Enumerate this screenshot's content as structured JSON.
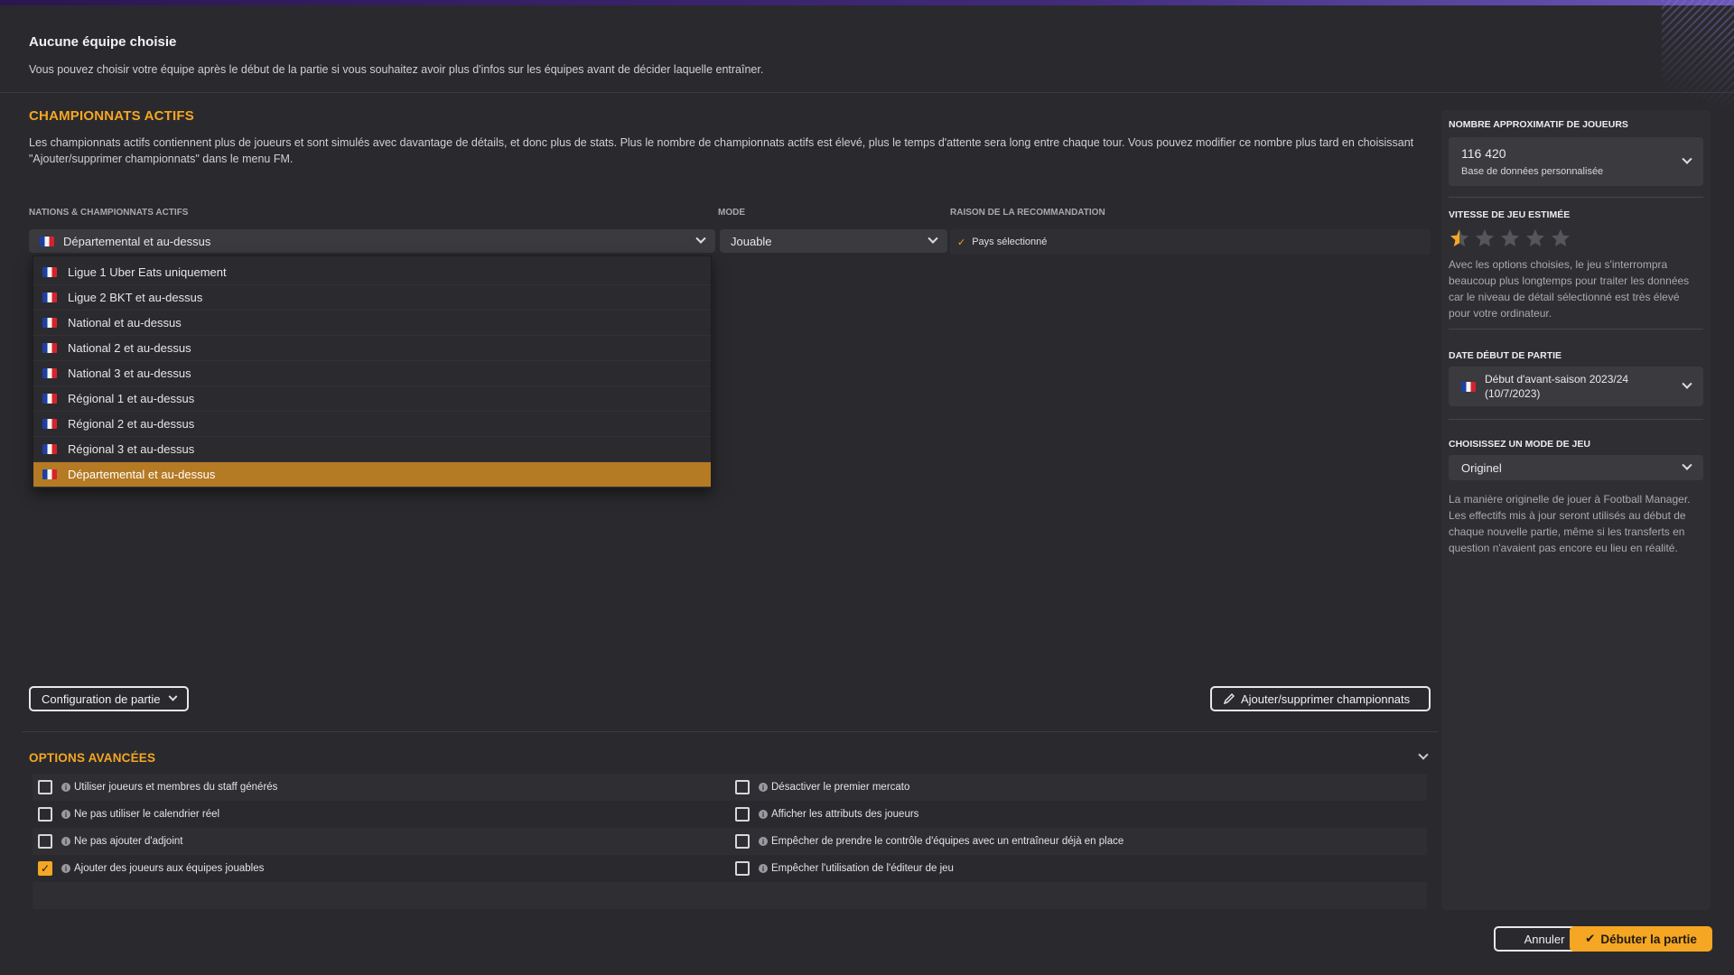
{
  "header": {
    "title": "Aucune équipe choisie",
    "subtitle": "Vous pouvez choisir votre équipe après le début de la partie si vous souhaitez avoir plus d'infos sur les équipes avant de décider laquelle entraîner."
  },
  "main": {
    "title": "CHAMPIONNATS ACTIFS",
    "description": "Les championnats actifs contiennent plus de joueurs et sont simulés avec davantage de détails, et donc plus de stats. Plus le nombre de championnats actifs est élevé, plus le temps d'attente sera long entre chaque tour. Vous pouvez modifier ce nombre plus tard en choisissant \"Ajouter/supprimer championnats\" dans le menu FM.",
    "columns": {
      "nations": "NATIONS & CHAMPIONNATS ACTIFS",
      "mode": "MODE",
      "reason": "RAISON DE LA RECOMMANDATION"
    },
    "nation_select": {
      "value": "Départemental et au-dessus"
    },
    "mode_select": {
      "value": "Jouable"
    },
    "reason": "Pays sélectionné",
    "dropdown_items": [
      {
        "label": "Ligue 1 Uber Eats uniquement"
      },
      {
        "label": "Ligue 2 BKT et au-dessus"
      },
      {
        "label": "National et au-dessus"
      },
      {
        "label": "National 2 et au-dessus"
      },
      {
        "label": "National 3 et au-dessus"
      },
      {
        "label": "Régional 1 et au-dessus"
      },
      {
        "label": "Régional 2 et au-dessus"
      },
      {
        "label": "Régional 3 et au-dessus"
      },
      {
        "label": "Départemental et au-dessus"
      }
    ],
    "selected_index": 8,
    "config_button": "Configuration de partie",
    "add_remove_button": "Ajouter/supprimer championnats"
  },
  "advanced": {
    "title": "OPTIONS AVANCÉES",
    "left": [
      {
        "label": "Utiliser joueurs et membres du staff générés",
        "checked": false
      },
      {
        "label": "Ne pas utiliser le calendrier réel",
        "checked": false
      },
      {
        "label": "Ne pas ajouter d'adjoint",
        "checked": false
      },
      {
        "label": "Ajouter des joueurs aux équipes jouables",
        "checked": true
      }
    ],
    "right": [
      {
        "label": "Désactiver le premier mercato",
        "checked": false
      },
      {
        "label": "Afficher les attributs des joueurs",
        "checked": false
      },
      {
        "label": "Empêcher de prendre le contrôle d'équipes avec un entraîneur déjà en place",
        "checked": false
      },
      {
        "label": "Empêcher l'utilisation de l'éditeur de jeu",
        "checked": false
      }
    ]
  },
  "sidebar": {
    "players_label": "NOMBRE APPROXIMATIF DE JOUEURS",
    "players_value": "116 420",
    "players_sub": "Base de données personnalisée",
    "speed_label": "VITESSE DE JEU ESTIMÉE",
    "speed_stars": 0.5,
    "speed_max": 5,
    "speed_text": "Avec les options choisies, le jeu s'interrompra beaucoup plus longtemps pour traiter les données car le niveau de détail sélectionné est très élevé pour votre ordinateur.",
    "date_label": "DATE DÉBUT DE PARTIE",
    "date_value_line1": "Début d'avant-saison 2023/24",
    "date_value_line2": "(10/7/2023)",
    "mode_label": "CHOISISSEZ UN MODE DE JEU",
    "mode_value": "Originel",
    "mode_text": "La manière originelle de jouer à Football Manager. Les effectifs mis à jour seront utilisés au début de chaque nouvelle partie, même si les transferts en question n'avaient pas encore eu lieu en réalité."
  },
  "footer": {
    "cancel": "Annuler",
    "start": "Débuter la partie"
  },
  "colors": {
    "accent": "#f5a623",
    "selected_item": "#b57a24",
    "background": "#2a2a2e"
  }
}
